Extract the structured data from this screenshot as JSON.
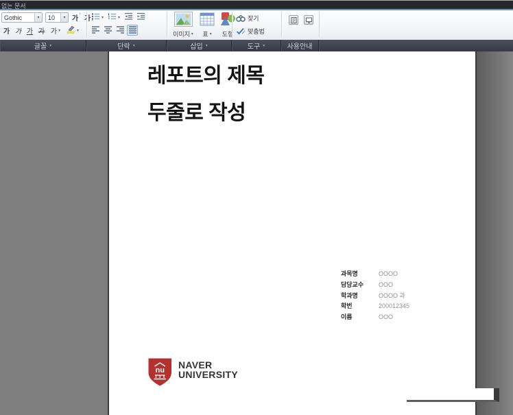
{
  "ui": {
    "dropdown_arrow": "▾",
    "inc_arrow": "↑",
    "dec_arrow": "↓"
  },
  "window": {
    "title": "없는 문서"
  },
  "toolbar": {
    "font_group": {
      "label": "글꼴",
      "font_name": "Gothic",
      "font_size": "10",
      "size_glyph": "가",
      "bold_glyph": "가",
      "italic_glyph": "가",
      "underline_glyph": "가",
      "strikethrough_glyph": "가",
      "font_color_glyph": "가"
    },
    "paragraph_group": {
      "label": "단락"
    },
    "insert_group": {
      "label": "삽입",
      "image_label": "이미지",
      "table_label": "표",
      "shape_label": "도형"
    },
    "tools_group": {
      "label": "도구",
      "find_label": "찾기",
      "spellcheck_label": "맞춤법"
    },
    "guide_group": {
      "label": "사용안내"
    }
  },
  "document": {
    "title_line1": "레포트의 제목",
    "title_line2": "두줄로 작성",
    "info": [
      {
        "label": "과목명",
        "value": "OOOO"
      },
      {
        "label": "담당교수",
        "value": "OOO"
      },
      {
        "label": "학과명",
        "value": "OOOO 과"
      },
      {
        "label": "학번",
        "value": "200012345"
      },
      {
        "label": "이름",
        "value": "OOO"
      }
    ],
    "logo": {
      "monogram": "nu",
      "line1": "NAVER",
      "line2": "UNIVERSITY",
      "shield_color": "#b5312d"
    }
  },
  "colors": {
    "accent_blue": "#4f7fb5",
    "band_bg": "#3a3f4b",
    "canvas_gray": "#7e7e7e",
    "shield_red": "#b5312d"
  }
}
